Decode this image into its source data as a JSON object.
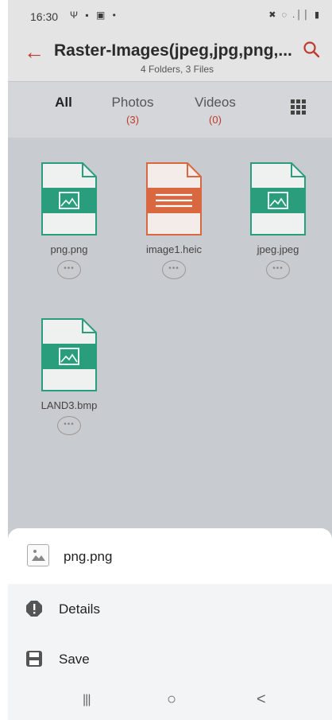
{
  "status": {
    "time": "16:30",
    "left_icons": "Ψ ▪ ▣ •",
    "right_icons": "✖ ◌ .││ ▮"
  },
  "appbar": {
    "title": "Raster-Images(jpeg,jpg,png,...",
    "subtitle": "4 Folders, 3 Files"
  },
  "tabs": [
    {
      "label": "All",
      "count": ""
    },
    {
      "label": "Photos",
      "count": "(3)"
    },
    {
      "label": "Videos",
      "count": "(0)"
    }
  ],
  "files": [
    {
      "name": "png.png",
      "icon": "image-file-icon",
      "color": "#2a9d7c"
    },
    {
      "name": "image1.heic",
      "icon": "document-file-icon",
      "color": "#d9673f"
    },
    {
      "name": "jpeg.jpeg",
      "icon": "image-file-icon",
      "color": "#2a9d7c"
    },
    {
      "name": "LAND3.bmp",
      "icon": "image-file-icon",
      "color": "#2a9d7c"
    }
  ],
  "more_glyph": "•••",
  "sheet": {
    "file_name": "png.png",
    "actions": [
      {
        "label": "Details",
        "icon": "info-icon"
      },
      {
        "label": "Save",
        "icon": "save-icon"
      }
    ]
  },
  "nav": {
    "recents": "|||",
    "home": "○",
    "back": "<"
  },
  "colors": {
    "accent": "#c0392b",
    "image_icon": "#2a9d7c",
    "doc_icon": "#d9673f"
  }
}
